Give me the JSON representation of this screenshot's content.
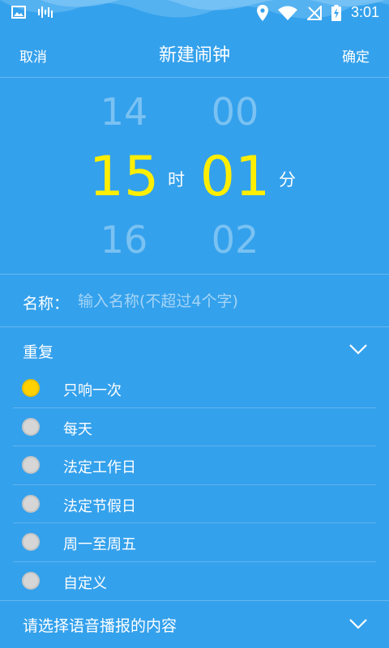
{
  "status_bar": {
    "time": "3:01",
    "left_icons": [
      "image-icon",
      "voice-wave-icon"
    ],
    "right_icons": [
      "location-icon",
      "wifi-icon",
      "no-sim-icon",
      "battery-charging-icon"
    ]
  },
  "header": {
    "cancel_label": "取消",
    "title": "新建闹钟",
    "confirm_label": "确定"
  },
  "time_picker": {
    "hour_prev": "14",
    "hour_selected": "15",
    "hour_next": "16",
    "hour_unit": "时",
    "minute_prev": "00",
    "minute_selected": "01",
    "minute_next": "02",
    "minute_unit": "分"
  },
  "name": {
    "label": "名称：",
    "value": "",
    "placeholder": "输入名称(不超过4个字)"
  },
  "repeat": {
    "label": "重复",
    "options": [
      {
        "label": "只响一次",
        "selected": true
      },
      {
        "label": "每天",
        "selected": false
      },
      {
        "label": "法定工作日",
        "selected": false
      },
      {
        "label": "法定节假日",
        "selected": false
      },
      {
        "label": "周一至周五",
        "selected": false
      },
      {
        "label": "自定义",
        "selected": false
      }
    ]
  },
  "voice": {
    "label": "请选择语音播报的内容"
  },
  "colors": {
    "background": "#34a1ec",
    "selected_time": "#ffee00",
    "radio_selected": "#ffd100",
    "radio_unselected": "#d6d6d6"
  }
}
